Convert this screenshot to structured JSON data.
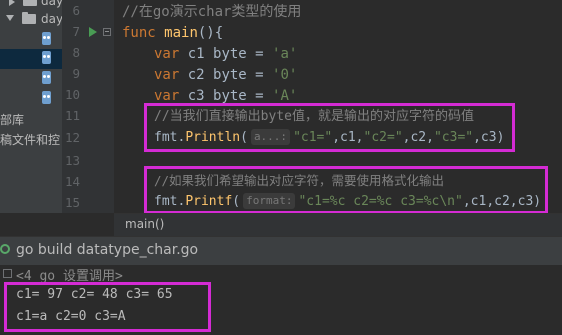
{
  "project_tree": {
    "items": [
      {
        "label": "day"
      },
      {
        "label": "day"
      },
      {
        "label": ""
      },
      {
        "label": ""
      },
      {
        "label": ""
      },
      {
        "label": ""
      }
    ],
    "side_labels": [
      "部库",
      "稿文件和控"
    ]
  },
  "editor": {
    "line_numbers": [
      "6",
      "7",
      "8",
      "9",
      "10",
      "11",
      "12",
      "13",
      "14",
      "15"
    ],
    "lines": {
      "l6_comment": "//在go演示char类型的使用",
      "l7_func": "func",
      "l7_name": "main",
      "l7_rest": "(){",
      "l8_var": "var",
      "l8_mid": " c1 byte = ",
      "l8_str": "'a'",
      "l9_var": "var",
      "l9_mid": " c2 byte = ",
      "l9_str": "'0'",
      "l10_var": "var",
      "l10_mid": " c3 byte = ",
      "l10_str": "'A'",
      "l11_comment": "//当我们直接输出byte值，就是输出的对应字符的码值",
      "l12_pkg": "fmt.",
      "l12_fn": "Println",
      "l12_open": "(",
      "l12_hint": "a...:",
      "l12_s1": "\"c1=\"",
      "l12_m1": ",c1,",
      "l12_s2": "\"c2=\"",
      "l12_m2": ",c2,",
      "l12_s3": "\"c3=\"",
      "l12_m3": ",c3)",
      "l14_comment": "//如果我们希望输出对应字符，需要使用格式化输出",
      "l15_pkg": "fmt.",
      "l15_fn": "Printf",
      "l15_open": "(",
      "l15_hint": "format:",
      "l15_str": "\"c1=%c c2=%c c3=%c\\n\"",
      "l15_rest": ",c1,c2,c3)"
    }
  },
  "breadcrumb": {
    "label": "main()"
  },
  "run_tool": {
    "tab_label": "go build datatype_char.go",
    "console_lines": [
      "<4 go 设置调用>",
      "c1= 97 c2= 48 c3= 65",
      "c1=a c2=0 c3=A"
    ]
  },
  "colors": {
    "highlight_box": "#D42BD4",
    "keyword": "#CC7832",
    "function": "#FFC66D",
    "string": "#6A8759",
    "comment": "#808080",
    "run_green": "#499C54"
  }
}
